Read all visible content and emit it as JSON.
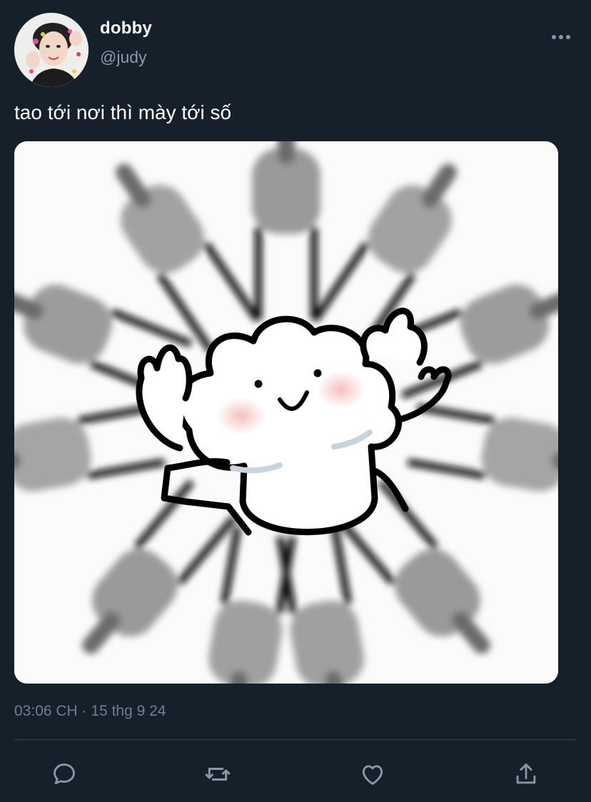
{
  "author": {
    "display_name": "dobby",
    "handle": "@judy"
  },
  "tweet": {
    "text": "tao tới nơi thì mày tới số",
    "timestamp": "03:06 CH · 15 thg 9 24"
  },
  "icons": {
    "more": "more-horizontal-icon",
    "reply": "reply-icon",
    "retweet": "retweet-icon",
    "like": "heart-icon",
    "share": "share-icon"
  },
  "colors": {
    "background": "#15202b",
    "secondary_text": "#8899a6",
    "icon": "#8899a6",
    "divider": "#38444d"
  }
}
